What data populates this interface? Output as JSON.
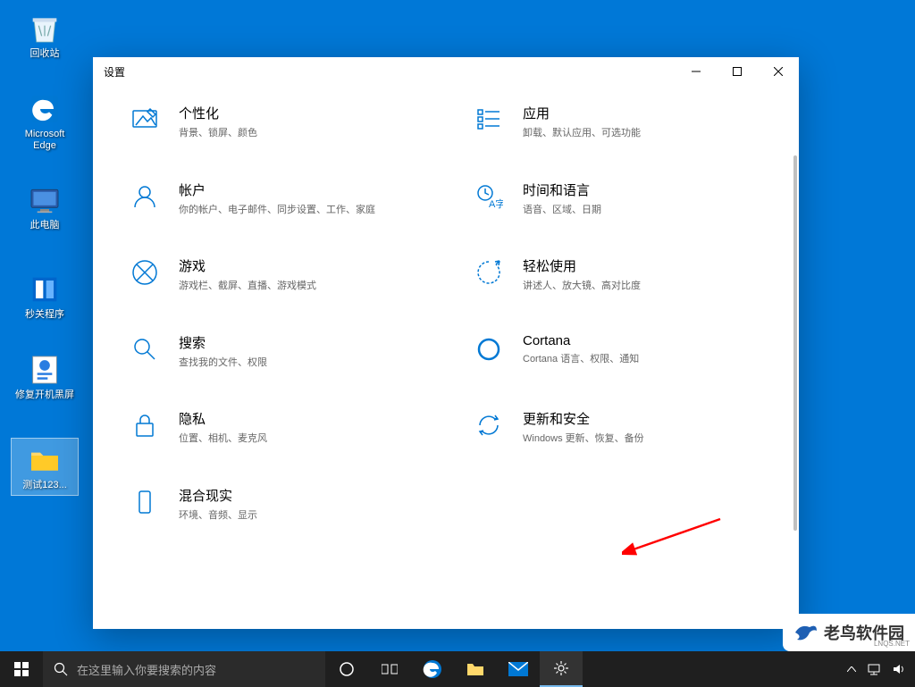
{
  "desktop_icons": [
    {
      "name": "recycle-bin",
      "label": "回收站"
    },
    {
      "name": "edge",
      "label": "Microsoft Edge"
    },
    {
      "name": "this-pc",
      "label": "此电脑"
    },
    {
      "name": "seconds-close",
      "label": "秒关程序"
    },
    {
      "name": "fix-boot",
      "label": "修复开机黑屏"
    },
    {
      "name": "test-folder",
      "label": "测试123..."
    }
  ],
  "window": {
    "title": "设置"
  },
  "categories": [
    {
      "id": "personalization",
      "title": "个性化",
      "desc": "背景、锁屏、颜色"
    },
    {
      "id": "apps",
      "title": "应用",
      "desc": "卸载、默认应用、可选功能"
    },
    {
      "id": "accounts",
      "title": "帐户",
      "desc": "你的帐户、电子邮件、同步设置、工作、家庭"
    },
    {
      "id": "time-language",
      "title": "时间和语言",
      "desc": "语音、区域、日期"
    },
    {
      "id": "gaming",
      "title": "游戏",
      "desc": "游戏栏、截屏、直播、游戏模式"
    },
    {
      "id": "ease-of-access",
      "title": "轻松使用",
      "desc": "讲述人、放大镜、高对比度"
    },
    {
      "id": "search",
      "title": "搜索",
      "desc": "查找我的文件、权限"
    },
    {
      "id": "cortana",
      "title": "Cortana",
      "desc": "Cortana 语言、权限、通知"
    },
    {
      "id": "privacy",
      "title": "隐私",
      "desc": "位置、相机、麦克风"
    },
    {
      "id": "update-security",
      "title": "更新和安全",
      "desc": "Windows 更新、恢复、备份"
    },
    {
      "id": "mixed-reality",
      "title": "混合现实",
      "desc": "环境、音频、显示"
    }
  ],
  "taskbar": {
    "search_placeholder": "在这里输入你要搜索的内容"
  },
  "watermark": {
    "text": "老鸟软件园",
    "sub": "LNQS.NET"
  }
}
